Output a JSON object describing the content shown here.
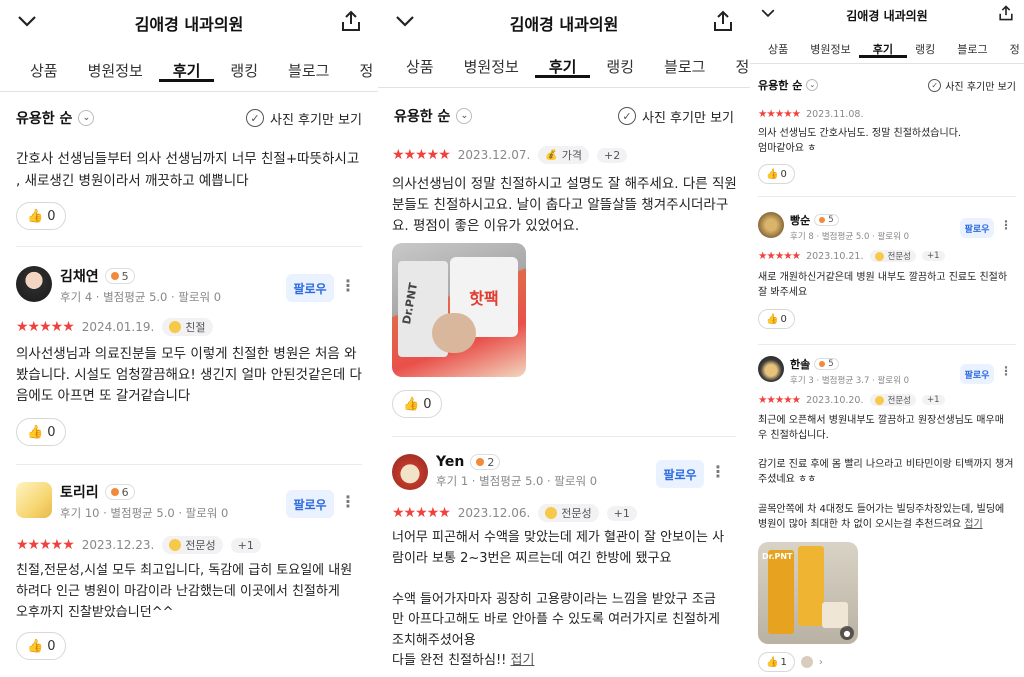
{
  "header": {
    "title": "김애경 내과의원"
  },
  "tabs": [
    "상품",
    "병원정보",
    "후기",
    "랭킹",
    "블로그",
    "정"
  ],
  "sort_label": "유용한 순",
  "photo_only_label": "사진 후기만 보기",
  "more_label": "접기",
  "panel1": {
    "review_top": {
      "text": "간호사 선생님들부터 의사 선생님까지 너무 친절+따뜻하시고\n, 새로생긴 병원이라서 깨끗하고 예쁩니다",
      "likes": "0"
    },
    "review_a": {
      "name": "김채연",
      "level": "5",
      "stats": "후기 4 · 별점평균 5.0 · 팔로워 0",
      "follow": "팔로우",
      "stars": "★★★★★",
      "date": "2024.01.19.",
      "tag": "친절",
      "text": "의사선생님과 의료진분들 모두 이렇게 친절한 병원은 처음 와\n봤습니다. 시설도 엄청깔끔해요! 생긴지 얼마 안된것같은데 다\n음에도 아프면 또 갈거같습니다",
      "likes": "0"
    },
    "review_b": {
      "name": "토리리",
      "level": "6",
      "stats": "후기 10 · 별점평균 5.0 · 팔로워 0",
      "follow": "팔로우",
      "stars": "★★★★★",
      "date": "2023.12.23.",
      "tag": "전문성",
      "plus": "+1",
      "text": "친절,전문성,시설 모두 최고입니다, 독감에 급히 토요일에 내원\n하려다 인근 병원이 마감이라 난감했는데 이곳에서 친절하게\n오후까지 진찰받았습니던^^",
      "likes": "0"
    }
  },
  "panel2": {
    "review_a": {
      "stars": "★★★★★",
      "date": "2023.12.07.",
      "tag": "가격",
      "plus": "+2",
      "text": "의사선생님이 정말 친절하시고 설명도 잘 해주세요. 다른 직원\n분들도 친절하시고요. 날이 춥다고 알뜰살뜰 챙겨주시더라구\n요. 평점이 좋은 이유가 있었어요.",
      "photo_brand": "Dr.PNT",
      "photo_pack": "핫팩",
      "likes": "0"
    },
    "review_b": {
      "name": "Yen",
      "level": "2",
      "stats": "후기 1 · 별점평균 5.0 · 팔로워 0",
      "follow": "팔로우",
      "stars": "★★★★★",
      "date": "2023.12.06.",
      "tag": "전문성",
      "plus": "+1",
      "text": "너어무 피곤해서 수액을 맞았는데 제가 혈관이 잘 안보이는 사\n람이라 보통 2~3번은 찌르는데 여긴 한방에 됐구요\n\n수액 들어가자마자 굉장히 고용량이라는 느낌을 받았구 조금\n만 아프다고해도 바로 안아플 수 있도록 여러가지로 친절하게\n조치해주셨어용\n다들 완전 친절하심!! "
    }
  },
  "panel3": {
    "review_a": {
      "stars": "★★★★★",
      "date": "2023.11.08.",
      "text": "의사 선생님도 간호사님도. 정말 친절하셨습니다.\n엄마같아요 ㅎ",
      "likes": "0"
    },
    "review_b": {
      "name": "빵순",
      "level": "5",
      "stats": "후기 8 · 별점평균 5.0 · 팔로워 0",
      "follow": "팔로우",
      "stars": "★★★★★",
      "date": "2023.10.21.",
      "tag": "전문성",
      "plus": "+1",
      "text": "새로 개원하신거같은데 병원 내부도 깔끔하고 진료도 친절하\n잘 봐주세요",
      "likes": "0"
    },
    "review_c": {
      "name": "한솔",
      "level": "5",
      "stats": "후기 3 · 별점평균 3.7 · 팔로워 0",
      "follow": "팔로우",
      "stars": "★★★★★",
      "date": "2023.10.20.",
      "tag": "전문성",
      "plus": "+1",
      "text": "최근에 오픈해서 병원내부도 깔끔하고 원장선생님도 매우매\n우 친절하십니다.\n\n감기로 진료 후에 몸 빨리 나으라고 비타민이랑 티백까지 챙겨\n주셨네요 ㅎㅎ\n\n골목안쪽에 차 4대정도 들어가는 빌딩주차장있는데, 빌딩에\n병원이 많아 최대한 차 없이 오시는걸 추천드려요 ",
      "photo_brand": "Dr.PNT",
      "likes": "1"
    }
  }
}
